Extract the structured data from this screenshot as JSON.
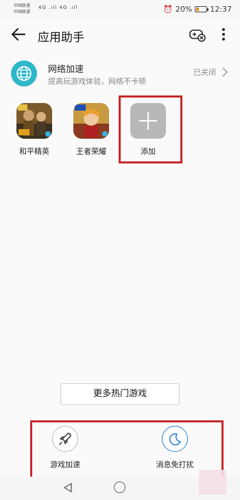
{
  "status_bar": {
    "carrier1": "中国联通",
    "carrier2": "中国联通",
    "signal_text": "4G .ıll 4G .ıll",
    "battery": "20%",
    "time": "12:37"
  },
  "header": {
    "title": "应用助手"
  },
  "network": {
    "title": "网络加速",
    "subtitle": "提高玩游戏体验，网络不卡顿",
    "status": "已关闭"
  },
  "games": [
    {
      "label": "和平精英",
      "icon": "game-peace-elite-icon"
    },
    {
      "label": "王者荣耀",
      "icon": "game-honor-of-kings-icon"
    }
  ],
  "add": {
    "label": "添加"
  },
  "more_button": "更多热门游戏",
  "tools": [
    {
      "label": "游戏加速",
      "icon": "rocket-icon"
    },
    {
      "label": "消息免打扰",
      "icon": "moon-icon"
    }
  ],
  "colors": {
    "accent": "#2fb8c8",
    "highlight": "#c8262a",
    "moon": "#2a7fd0"
  }
}
